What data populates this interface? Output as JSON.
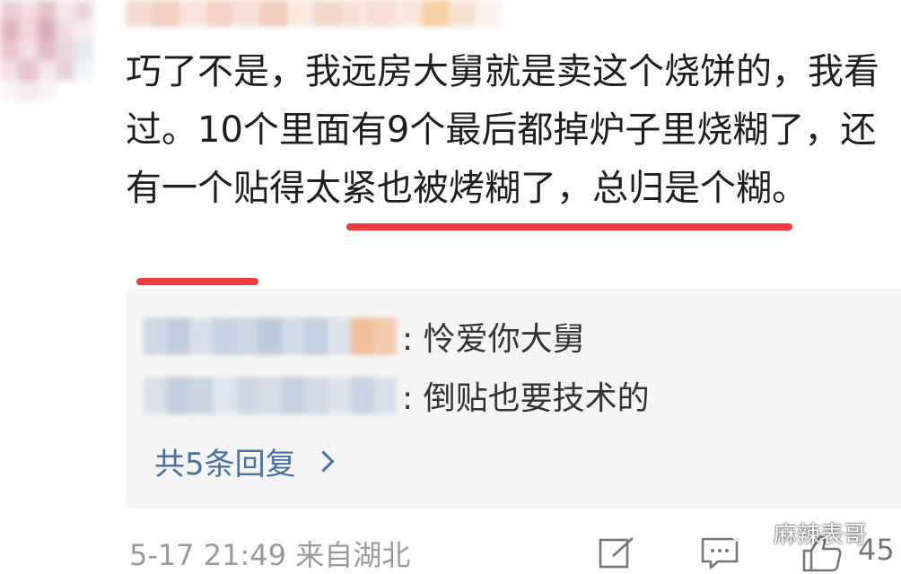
{
  "comment": {
    "text": "巧了不是，我远房大舅就是卖这个烧饼的，我看过。10个里面有9个最后都掉炉子里烧糊了，还有一个贴得太紧也被烤糊了，总归是个糊。"
  },
  "replies": [
    {
      "text": ": 怜爱你大舅"
    },
    {
      "text": ": 倒贴也要技术的"
    }
  ],
  "more_replies": {
    "label": "共5条回复"
  },
  "footer": {
    "meta": "5-17 21:49  来自湖北",
    "like_count": "45"
  },
  "watermark": {
    "text": "麻辣表哥"
  },
  "icons": {
    "edit": "edit-icon",
    "comment": "comment-icon",
    "like": "thumbs-up-icon",
    "more": "chevron-right-icon",
    "watermark": "wechat-icon"
  },
  "colors": {
    "underline": "#ee3b3b",
    "link": "#4a6fa5",
    "reply_bg": "#f5f5f5"
  }
}
